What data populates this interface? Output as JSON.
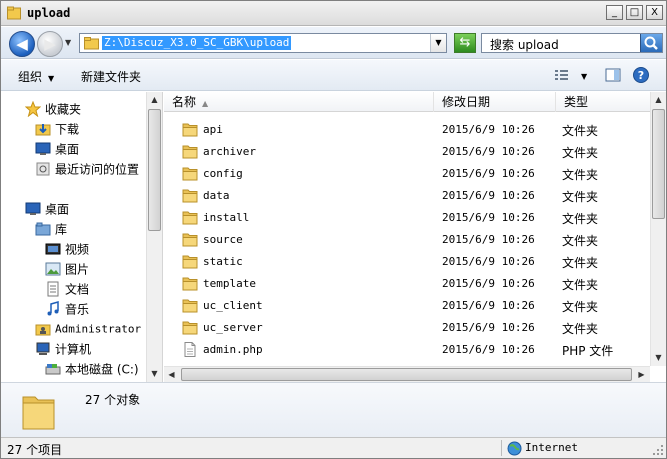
{
  "window": {
    "title": "upload"
  },
  "title_buttons": {
    "minimize": "_",
    "maximize": "□",
    "close": "X"
  },
  "address": {
    "path": "Z:\\Discuz_X3.0_SC_GBK\\upload",
    "search_placeholder": "搜索 upload"
  },
  "toolbar": {
    "organize": "组织",
    "new_folder": "新建文件夹"
  },
  "nav": {
    "favorites": "收藏夹",
    "downloads": "下载",
    "desktop_fav": "桌面",
    "recent": "最近访问的位置",
    "desktop": "桌面",
    "libraries": "库",
    "videos": "视频",
    "pictures": "图片",
    "documents": "文档",
    "music": "音乐",
    "administrator": "Administrator",
    "computer": "计算机",
    "local_disk": "本地磁盘 (C:)"
  },
  "columns": {
    "name": "名称",
    "date": "修改日期",
    "type": "类型"
  },
  "files": [
    {
      "name": "api",
      "date": "2015/6/9 10:26",
      "type": "文件夹",
      "icon": "folder-icon"
    },
    {
      "name": "archiver",
      "date": "2015/6/9 10:26",
      "type": "文件夹",
      "icon": "folder-icon"
    },
    {
      "name": "config",
      "date": "2015/6/9 10:26",
      "type": "文件夹",
      "icon": "folder-icon"
    },
    {
      "name": "data",
      "date": "2015/6/9 10:26",
      "type": "文件夹",
      "icon": "folder-icon"
    },
    {
      "name": "install",
      "date": "2015/6/9 10:26",
      "type": "文件夹",
      "icon": "folder-icon"
    },
    {
      "name": "source",
      "date": "2015/6/9 10:26",
      "type": "文件夹",
      "icon": "folder-icon"
    },
    {
      "name": "static",
      "date": "2015/6/9 10:26",
      "type": "文件夹",
      "icon": "folder-icon"
    },
    {
      "name": "template",
      "date": "2015/6/9 10:26",
      "type": "文件夹",
      "icon": "folder-icon"
    },
    {
      "name": "uc_client",
      "date": "2015/6/9 10:26",
      "type": "文件夹",
      "icon": "folder-icon"
    },
    {
      "name": "uc_server",
      "date": "2015/6/9 10:26",
      "type": "文件夹",
      "icon": "folder-icon"
    },
    {
      "name": "admin.php",
      "date": "2015/6/9 10:26",
      "type": "PHP 文件",
      "icon": "php-file-icon"
    }
  ],
  "details": {
    "summary": "27 个对象"
  },
  "status": {
    "item_count": "27 个项目",
    "zone": "Internet"
  },
  "colors": {
    "selection": "#3399ff",
    "folder": "#f2c94c",
    "window_border": "#7f7f7f"
  }
}
